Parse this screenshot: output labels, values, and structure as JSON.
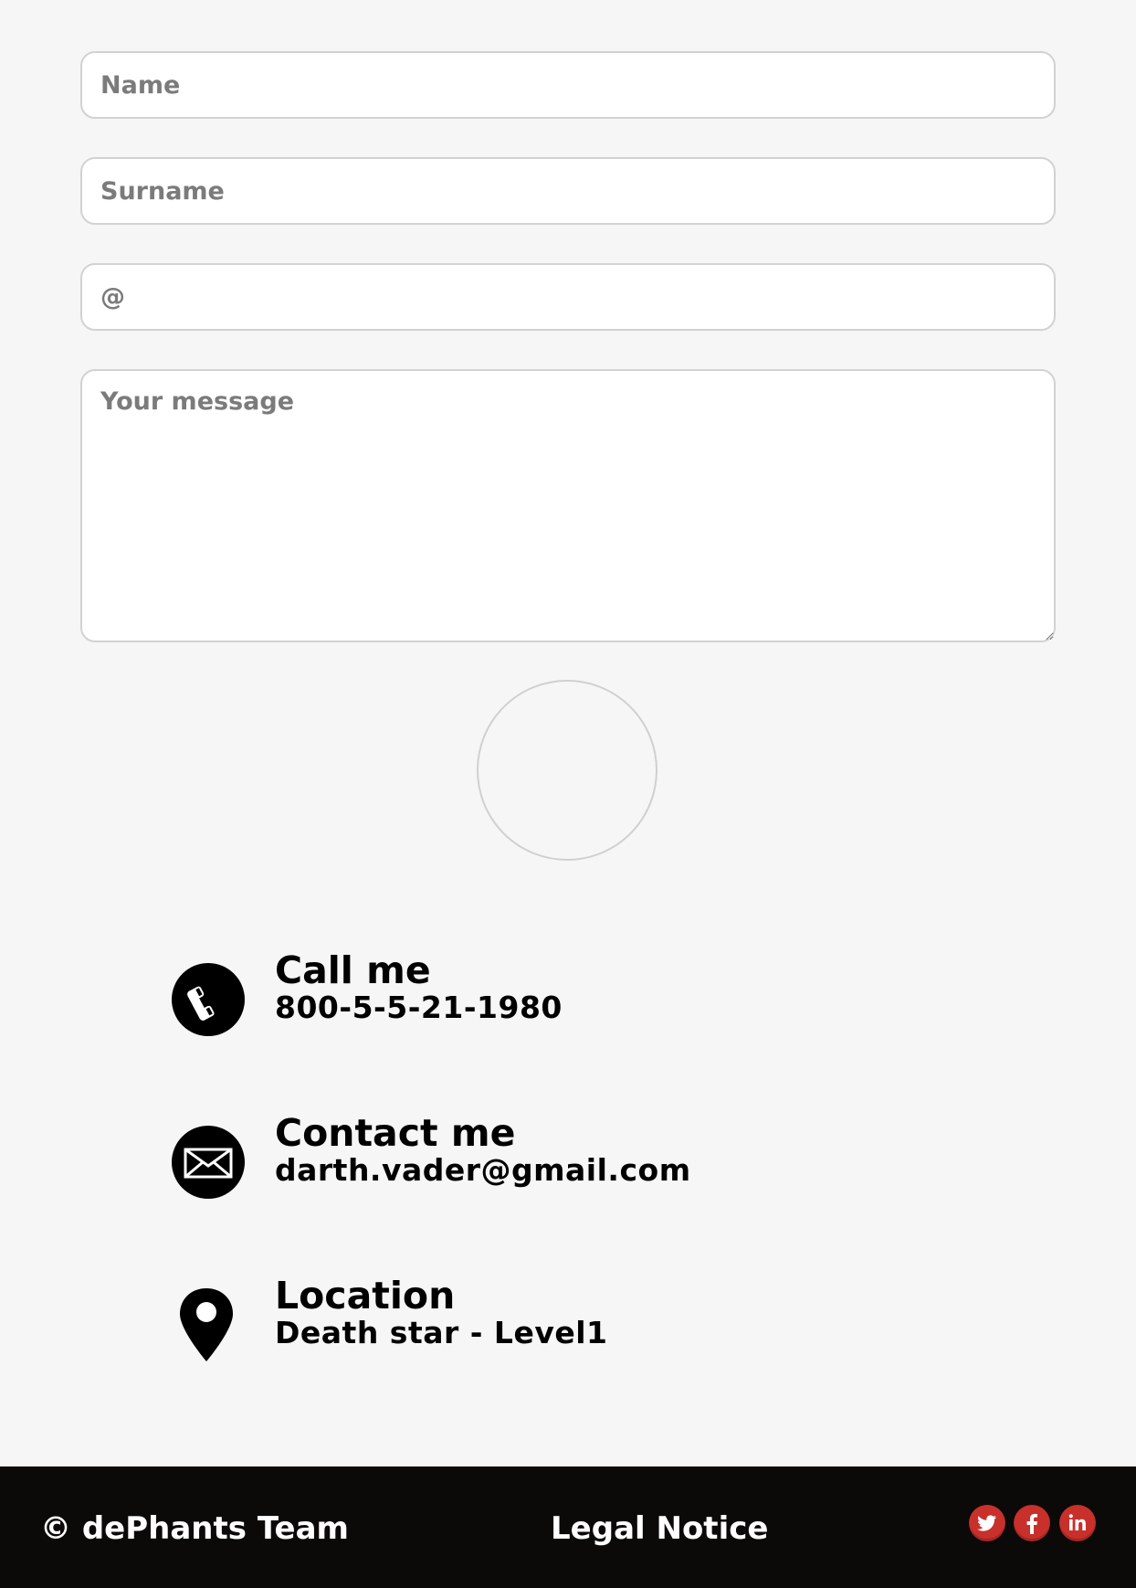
{
  "form": {
    "name_placeholder": "Name",
    "surname_placeholder": "Surname",
    "email_placeholder": "@",
    "message_placeholder": "Your message"
  },
  "contacts": [
    {
      "icon": "phone-icon",
      "title": "Call me",
      "value": "800-5-5-21-1980"
    },
    {
      "icon": "envelope-icon",
      "title": "Contact me",
      "value": "darth.vader@gmail.com"
    },
    {
      "icon": "location-pin-icon",
      "title": "Location",
      "value": "Death star - Level1"
    }
  ],
  "footer": {
    "copyright": "© dePhants Team",
    "legal": "Legal Notice",
    "social": [
      {
        "icon": "twitter-icon"
      },
      {
        "icon": "facebook-icon"
      },
      {
        "icon": "linkedin-icon"
      }
    ]
  },
  "colors": {
    "background": "#f6f6f6",
    "footer_background": "#0b0a08",
    "social_accent": "#c8302c",
    "field_border": "#d2d2d2"
  }
}
